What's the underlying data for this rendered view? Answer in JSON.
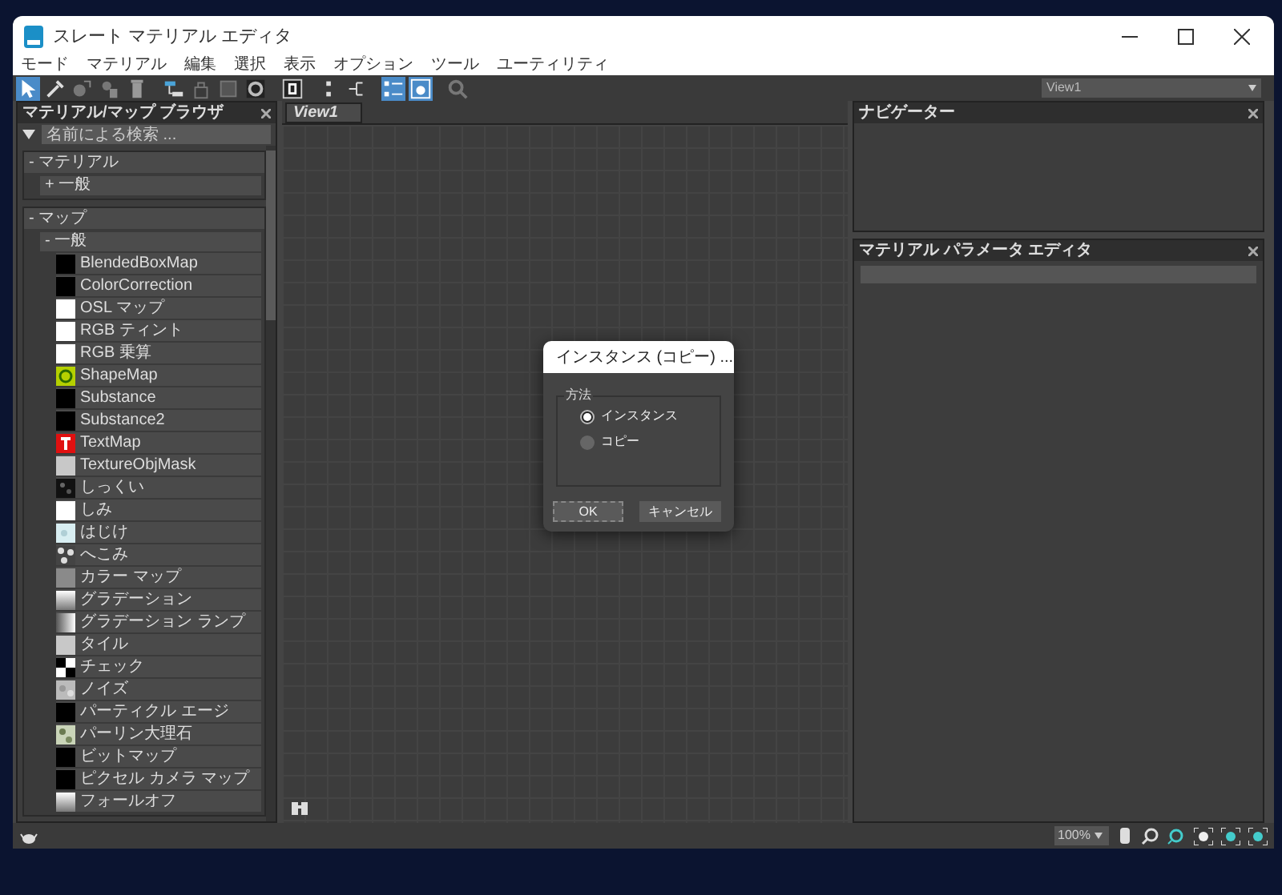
{
  "window": {
    "title": "スレート マテリアル エディタ"
  },
  "menu": [
    "モード",
    "マテリアル",
    "編集",
    "選択",
    "表示",
    "オプション",
    "ツール",
    "ユーティリティ"
  ],
  "toolbar": [
    {
      "kind": "pointer",
      "on": true
    },
    {
      "kind": "dropper",
      "on": false
    },
    {
      "kind": "put",
      "on": false
    },
    {
      "kind": "assign",
      "on": false
    },
    {
      "kind": "trash",
      "on": false
    },
    {
      "kind": "layout",
      "on": false
    },
    {
      "kind": "lock",
      "on": false
    },
    {
      "kind": "square",
      "on": false
    },
    {
      "kind": "sphere",
      "on": false
    },
    {
      "kind": "zero",
      "on": false
    },
    {
      "kind": "dots",
      "on": false
    },
    {
      "kind": "tree",
      "on": false
    },
    {
      "kind": "list",
      "on": true
    },
    {
      "kind": "preview",
      "on": true
    },
    {
      "kind": "magnet",
      "on": false
    }
  ],
  "view_select": {
    "value": "View1"
  },
  "browser": {
    "title": "マテリアル/マップ ブラウザ",
    "search": {
      "placeholder": "名前による検索 ..."
    },
    "sections": [
      {
        "label": "- マテリアル",
        "groups": [
          {
            "label": "+ 一般"
          }
        ]
      },
      {
        "label": "- マップ",
        "groups": [
          {
            "label": "- 一般",
            "items": [
              {
                "label": "BlendedBoxMap",
                "kind": "black"
              },
              {
                "label": "ColorCorrection",
                "kind": "black"
              },
              {
                "label": "OSL マップ",
                "kind": "white"
              },
              {
                "label": "RGB ティント",
                "kind": "white"
              },
              {
                "label": "RGB 乗算",
                "kind": "white"
              },
              {
                "label": "ShapeMap",
                "kind": "shape"
              },
              {
                "label": "Substance",
                "kind": "black"
              },
              {
                "label": "Substance2",
                "kind": "black"
              },
              {
                "label": "TextMap",
                "kind": "text"
              },
              {
                "label": "TextureObjMask",
                "kind": "light"
              },
              {
                "label": "しっくい",
                "kind": "stucco"
              },
              {
                "label": "しみ",
                "kind": "white"
              },
              {
                "label": "はじけ",
                "kind": "splat"
              },
              {
                "label": "へこみ",
                "kind": "dent"
              },
              {
                "label": "カラー マップ",
                "kind": "gray"
              },
              {
                "label": "グラデーション",
                "kind": "gradient"
              },
              {
                "label": "グラデーション ランプ",
                "kind": "ramp"
              },
              {
                "label": "タイル",
                "kind": "light"
              },
              {
                "label": "チェック",
                "kind": "check"
              },
              {
                "label": "ノイズ",
                "kind": "noise"
              },
              {
                "label": "パーティクル エージ",
                "kind": "black"
              },
              {
                "label": "パーリン大理石",
                "kind": "marble"
              },
              {
                "label": "ビットマップ",
                "kind": "black"
              },
              {
                "label": "ピクセル カメラ マップ",
                "kind": "black"
              },
              {
                "label": "フォールオフ",
                "kind": "gradient"
              }
            ]
          }
        ]
      }
    ]
  },
  "view_tab": {
    "label": "View1",
    "selected": true
  },
  "navigator": {
    "title": "ナビゲーター"
  },
  "parameter_editor": {
    "title": "マテリアル パラメータ エディタ"
  },
  "dialog": {
    "title": "インスタンス (コピー) ...",
    "group": "方法",
    "options": [
      {
        "label": "インスタンス",
        "selected": true
      },
      {
        "label": "コピー",
        "selected": false
      }
    ],
    "buttons": [
      "OK",
      "キャンセル"
    ]
  },
  "status_bar": {
    "zoom": "100%"
  }
}
